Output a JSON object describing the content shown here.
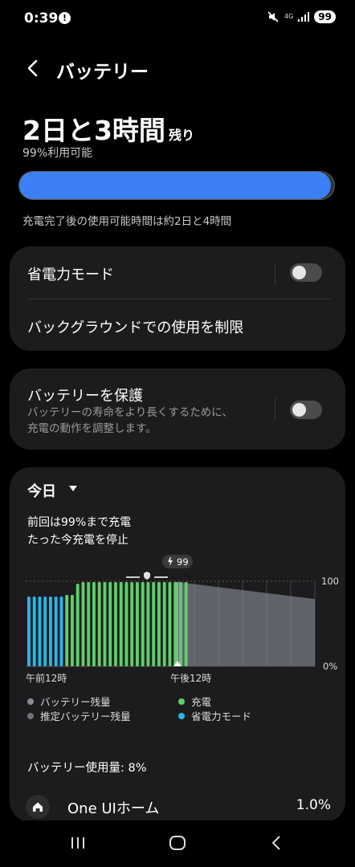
{
  "status_bar": {
    "time": "0:39",
    "alert_glyph": "!",
    "network": "4G",
    "battery_level": "99"
  },
  "header": {
    "title": "バッテリー"
  },
  "summary": {
    "remaining_main": "2日と3時間",
    "remaining_suffix": "残り",
    "available": "99%利用可能",
    "battery_percent": 99,
    "estimate": "充電完了後の使用可能時間は約2日と4時間"
  },
  "power_saving_card": {
    "power_saving_label": "省電力モード",
    "power_saving_enabled": false,
    "background_limit_label": "バックグラウンドでの使用を制限"
  },
  "protect_card": {
    "title": "バッテリーを保護",
    "description_line1": "バッテリーの寿命をより長くするために、",
    "description_line2": "充電の動作を調整します。",
    "enabled": false
  },
  "usage_card": {
    "period": "今日",
    "note_line1": "前回は99%まで充電",
    "note_line2": "たった今充電を停止",
    "usage_label": "バッテリー使用量: 8%",
    "app": {
      "name": "One UIホーム",
      "percent": "1.0%"
    }
  },
  "chart_data": {
    "type": "bar",
    "title": "",
    "x_tick_labels": [
      "午前12時",
      "午後12時"
    ],
    "y_tick_labels": [
      "100",
      "0%"
    ],
    "ylim": [
      0,
      100
    ],
    "current_marker": "99",
    "series": [
      {
        "name": "省電力モード",
        "color": "#29b6e6",
        "values": [
          82,
          82,
          82,
          82,
          82,
          82,
          82
        ]
      },
      {
        "name": "充電",
        "color": "#5dcf6a",
        "values": [
          84,
          84,
          97,
          99,
          99,
          99,
          99,
          99,
          99,
          99,
          99,
          99,
          99,
          99,
          99,
          99,
          99,
          99,
          99,
          99,
          99,
          99,
          99
        ]
      },
      {
        "name": "推定バッテリー残量",
        "color": "#6d7078",
        "start": 99,
        "end": 79
      }
    ],
    "legend": [
      {
        "label": "バッテリー残量",
        "color": "#8a8d94"
      },
      {
        "label": "充電",
        "color": "#5dcf6a"
      },
      {
        "label": "推定バッテリー残量",
        "color": "#6d7078"
      },
      {
        "label": "省電力モード",
        "color": "#29b6e6"
      }
    ]
  }
}
